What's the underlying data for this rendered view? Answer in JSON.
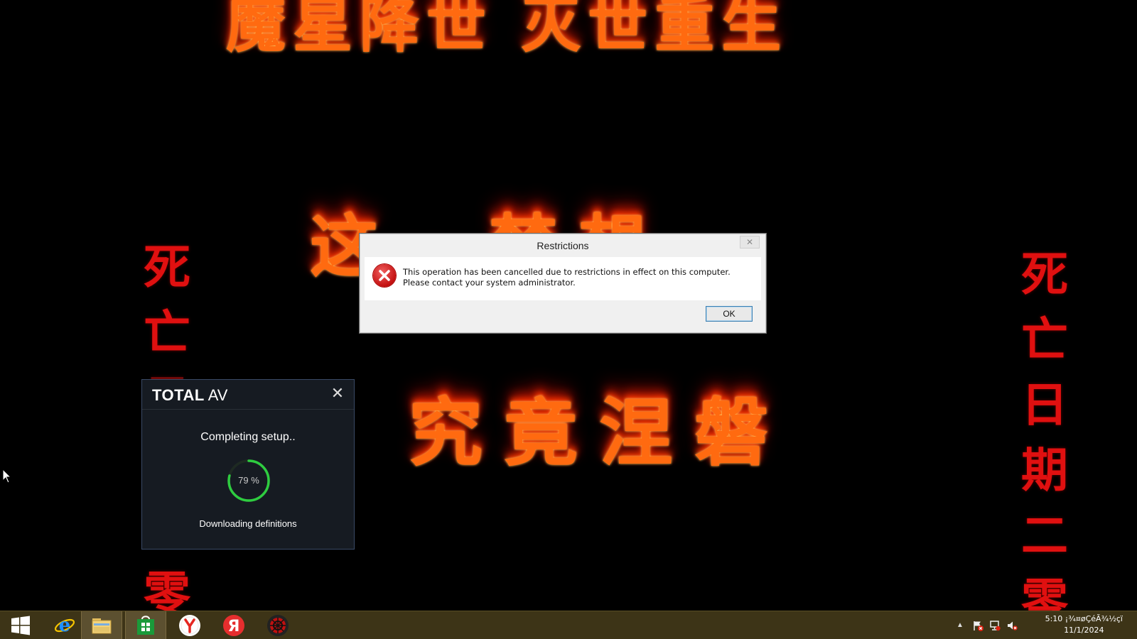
{
  "wallpaper": {
    "top_text": "魔星降世  灭世重生",
    "middle_text": "这…梦想",
    "lower_text": "究竟涅磐",
    "left_column": [
      "死",
      "亡",
      "日",
      "零"
    ],
    "right_column": [
      "死",
      "亡",
      "日",
      "期",
      "二",
      "零"
    ]
  },
  "dialog": {
    "title": "Restrictions",
    "message": "This operation has been cancelled due to restrictions in effect on this computer. Please contact your system administrator.",
    "ok_label": "OK",
    "close_glyph": "✕",
    "icon": "error-icon"
  },
  "totalav": {
    "logo_bold": "TOTAL",
    "logo_light": "AV",
    "close_glyph": "✕",
    "status": "Completing setup..",
    "percent_label": "79 %",
    "progress": 0.79,
    "substatus": "Downloading definitions",
    "accent": "#2ecc40"
  },
  "taskbar": {
    "items": [
      {
        "name": "start-button",
        "icon": "windows-icon"
      },
      {
        "name": "internet-explorer",
        "icon": "ie-icon"
      },
      {
        "name": "file-explorer",
        "icon": "folder-icon"
      },
      {
        "name": "store",
        "icon": "store-icon"
      },
      {
        "name": "yandex-browser",
        "icon": "yandex-browser-icon"
      },
      {
        "name": "yandex",
        "icon": "yandex-icon"
      },
      {
        "name": "red-app",
        "icon": "app-icon"
      }
    ],
    "tray": {
      "chevron": "▲",
      "time": "5:10 ¡¾¤øÇéÃ¾½çï",
      "date": "11/1/2024"
    },
    "color": "#3d3417"
  }
}
